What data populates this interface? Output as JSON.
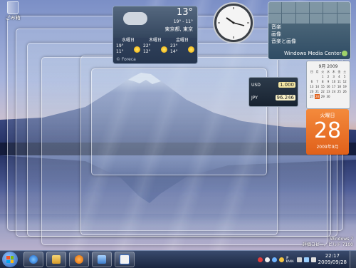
{
  "desktop": {
    "recycle_bin_label": "ごみ箱"
  },
  "weather_gadget": {
    "current_temp": "13°",
    "range": "19° - 11°",
    "location": "東京都, 東京",
    "forecast": [
      {
        "day": "水曜日",
        "high": "19°",
        "low": "11°",
        "icon": "sun-icon"
      },
      {
        "day": "木曜日",
        "high": "22°",
        "low": "12°",
        "icon": "sun-icon"
      },
      {
        "day": "金曜日",
        "high": "23°",
        "low": "14°",
        "icon": "sun-icon"
      }
    ],
    "provider": "© Foreca"
  },
  "media_center_gadget": {
    "menu_items": [
      "音楽",
      "画像",
      "音楽と画像"
    ],
    "title": "Windows Media Center"
  },
  "currency_gadget": {
    "rows": [
      {
        "code": "USD",
        "value": "1.000"
      },
      {
        "code": "JPY",
        "value": "96.246"
      }
    ]
  },
  "calendar_gadget": {
    "month_header": "9月 2009",
    "weekdays": [
      "日",
      "月",
      "火",
      "水",
      "木",
      "金",
      "土"
    ],
    "days": [
      "",
      "",
      "1",
      "2",
      "3",
      "4",
      "5",
      "6",
      "7",
      "8",
      "9",
      "10",
      "11",
      "12",
      "13",
      "14",
      "15",
      "16",
      "17",
      "18",
      "19",
      "20",
      "21",
      "22",
      "23",
      "24",
      "25",
      "26",
      "27",
      "28",
      "29",
      "30",
      "",
      "",
      ""
    ],
    "day_of_week": "火曜日",
    "day_number": "28",
    "full_date": "2009年9月"
  },
  "watermark": {
    "line1": "Windows 7",
    "line2": "評価コピー。ビルド 7100"
  },
  "taskbar": {
    "time": "22:17",
    "date": "2009/09/28",
    "lang_line1": "JP",
    "lang_line2": "KANA"
  },
  "colors": {
    "accent_orange": "#e0601a",
    "taskbar": "#1a2640"
  }
}
